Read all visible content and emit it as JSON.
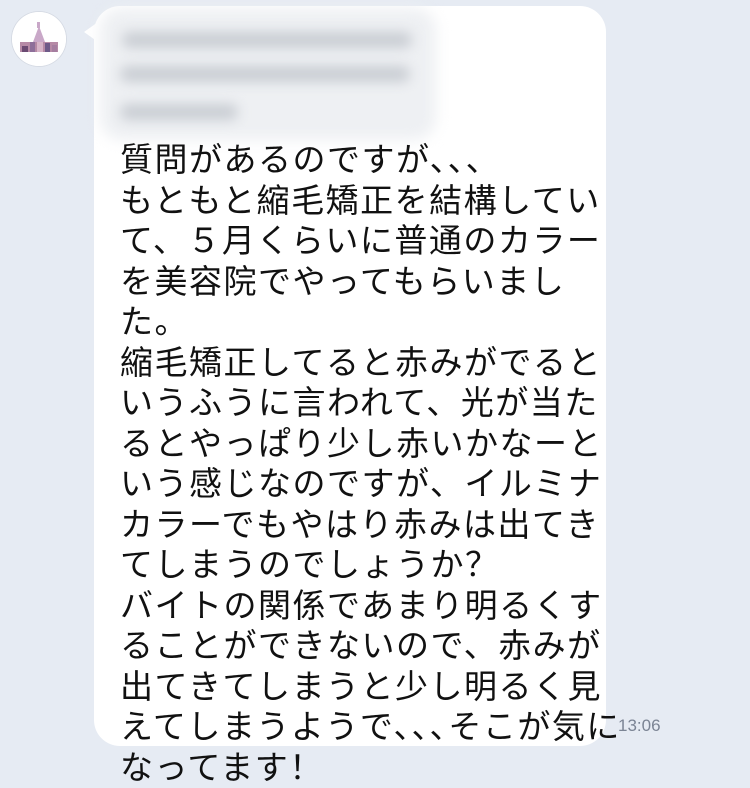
{
  "message": {
    "lines": [
      "質問があるのですが､､､",
      "もともと縮毛矯正を結構してい",
      "て、５月くらいに普通のカラー",
      "を美容院でやってもらいまし",
      "た。",
      "縮毛矯正してると赤みがでると",
      "いうふうに言われて、光が当た",
      "るとやっぱり少し赤いかなーと",
      "いう感じなのですが、イルミナ",
      "カラーでもやはり赤みは出てき",
      "てしまうのでしょうか？",
      "バイトの関係であまり明るくす",
      "ることができないので、赤みが",
      "出てきてしまうと少し明るく見",
      "えてしまうようで､､､そこが気に",
      "なってます！"
    ],
    "timestamp": "13:06"
  },
  "colors": {
    "background": "#e6ebf3",
    "bubble": "#ffffff",
    "text": "#111111",
    "timestamp": "#7b8494"
  }
}
